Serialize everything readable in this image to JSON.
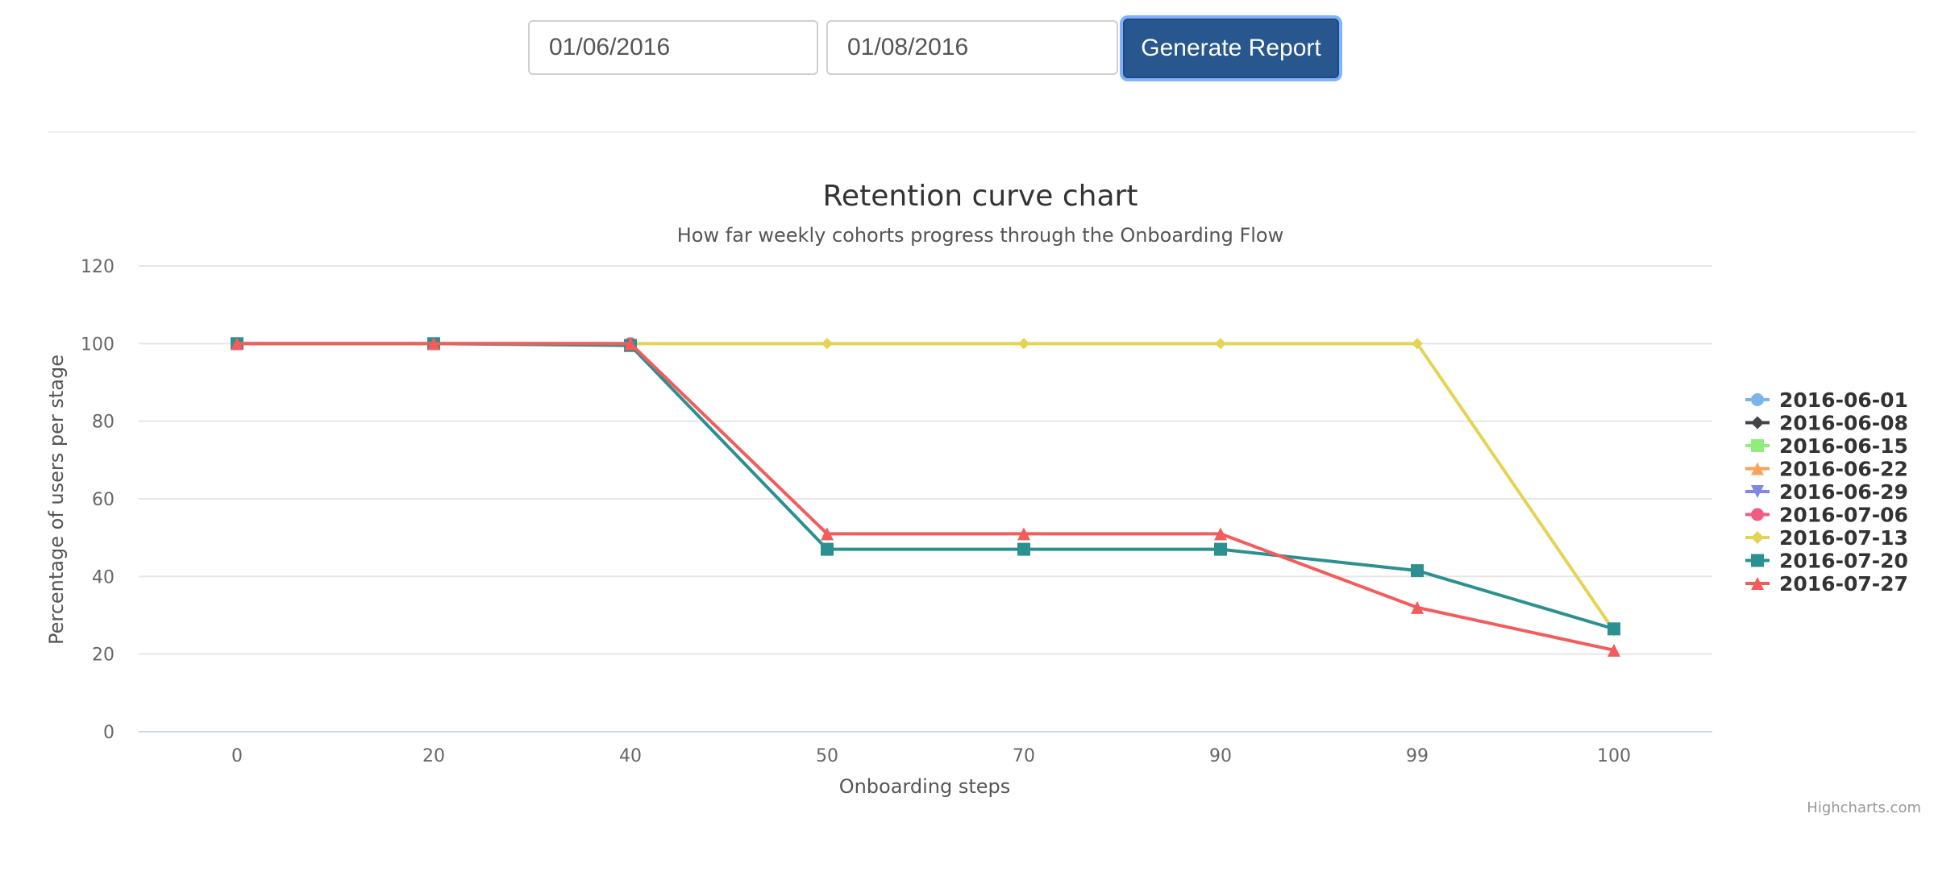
{
  "form": {
    "start_date": "01/06/2016",
    "end_date": "01/08/2016",
    "generate_label": "Generate Report"
  },
  "credits": "Highcharts.com",
  "chart_data": {
    "type": "line",
    "title": "Retention curve chart",
    "subtitle": "How far weekly cohorts progress through the Onboarding Flow",
    "xlabel": "Onboarding steps",
    "ylabel": "Percentage of users per stage",
    "categories": [
      "0",
      "20",
      "40",
      "50",
      "70",
      "90",
      "99",
      "100"
    ],
    "ylim": [
      0,
      120
    ],
    "yticks": [
      0,
      20,
      40,
      60,
      80,
      100,
      120
    ],
    "grid": true,
    "legend_position": "right",
    "series": [
      {
        "name": "2016-06-01",
        "color": "#7cb5ec",
        "marker": "circle",
        "values": []
      },
      {
        "name": "2016-06-08",
        "color": "#434348",
        "marker": "diamond",
        "values": []
      },
      {
        "name": "2016-06-15",
        "color": "#90ed7d",
        "marker": "square",
        "values": []
      },
      {
        "name": "2016-06-22",
        "color": "#f7a35c",
        "marker": "triangle",
        "values": []
      },
      {
        "name": "2016-06-29",
        "color": "#8085e9",
        "marker": "triangle-down",
        "values": []
      },
      {
        "name": "2016-07-06",
        "color": "#f15c80",
        "marker": "circle",
        "values": [
          100,
          100,
          100
        ]
      },
      {
        "name": "2016-07-13",
        "color": "#e4d354",
        "marker": "diamond",
        "values": [
          100,
          100,
          100,
          100,
          100,
          100,
          100,
          26
        ]
      },
      {
        "name": "2016-07-20",
        "color": "#2b908f",
        "marker": "square",
        "values": [
          100,
          100,
          99.5,
          47,
          47,
          47,
          41.5,
          26.5
        ]
      },
      {
        "name": "2016-07-27",
        "color": "#f45b5b",
        "marker": "triangle",
        "values": [
          100,
          100,
          100,
          51,
          51,
          51,
          32,
          21
        ]
      }
    ]
  }
}
